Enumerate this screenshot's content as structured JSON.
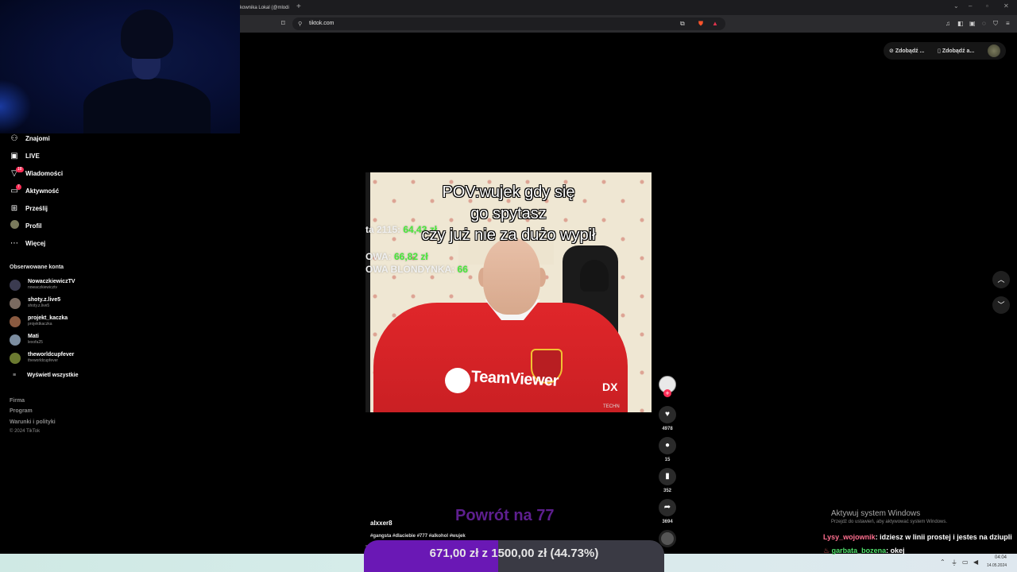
{
  "browser": {
    "tab_title": "kownika Lokal (@mlodi",
    "new_tab": "+",
    "url": "tiktok.com",
    "window_controls": [
      "⌄",
      "–",
      "▫",
      "✕"
    ]
  },
  "tiktok": {
    "top_actions": [
      "Zdobądź ...",
      "Zdobądź a..."
    ],
    "nav": [
      {
        "label": "Znajomi",
        "icon": "people-icon"
      },
      {
        "label": "LIVE",
        "icon": "live-icon"
      },
      {
        "label": "Wiadomości",
        "icon": "messages-icon",
        "badge": "18"
      },
      {
        "label": "Aktywność",
        "icon": "activity-icon",
        "badge": "7"
      },
      {
        "label": "Prześlij",
        "icon": "upload-icon"
      },
      {
        "label": "Profil",
        "icon": "profile-icon"
      },
      {
        "label": "Więcej",
        "icon": "more-icon"
      }
    ],
    "followed_title": "Obserwowane konta",
    "followed": [
      {
        "name": "NowaczkiewiczTV",
        "handle": "nowaczkiewicztv",
        "color": "#3b3b50"
      },
      {
        "name": "shoty.z.live5",
        "handle": "shoty.z.live5",
        "color": "#7a6a60"
      },
      {
        "name": "projekt_kaczka",
        "handle": "projektkaczka",
        "color": "#8a5a40"
      },
      {
        "name": "Mati",
        "handle": "lexofa25",
        "color": "#7c8da0"
      },
      {
        "name": "theworldcupfever",
        "handle": "theworldcupfever",
        "color": "#6b7a30"
      }
    ],
    "see_all": "Wyświetl wszystkie",
    "footer": [
      "Firma",
      "Program",
      "Warunki i polityki"
    ],
    "copyright": "© 2024 TikTok",
    "video": {
      "caption_lines": [
        "POV:wujek gdy się",
        "go spytasz",
        "czy już nie za dużo wypił"
      ],
      "overlay_lines": [
        {
          "text": "ta 2115: ",
          "value": "64,43 zł"
        },
        {
          "text": "OWA: ",
          "value": "66,82 zł"
        },
        {
          "text": "OWA BLONDYNKA: ",
          "value": "66"
        }
      ],
      "shirt_text": "TeamViewer",
      "dx_text": "DX",
      "techno_text": "TECHN"
    },
    "actions": {
      "likes": "4978",
      "comments": "15",
      "saves": "352",
      "shares": "3694"
    },
    "author": "alxxer8",
    "hashtags": "#gangsta #dlaciebie #777 #alkohol #wujek"
  },
  "stream": {
    "goal_title": "Powrót na 77",
    "goal_text": "671,00 zł z 1500,00 zł (44.73%)",
    "goal_fraction": 0.4473,
    "activation_title": "Aktywuj system Windows",
    "activation_sub": "Przejdź do ustawień, aby aktywować system Windows.",
    "chat": [
      {
        "user": "Lysy_wojownik",
        "user_color": "#ff6f8f",
        "message": ": idziesz w linii prostej i jestes na dziupli"
      },
      {
        "user": "garbata_bozena",
        "user_color": "#4fe06a",
        "message": ": okej"
      }
    ]
  },
  "taskbar": {
    "time": "04:04",
    "date": "14.05.2024"
  }
}
